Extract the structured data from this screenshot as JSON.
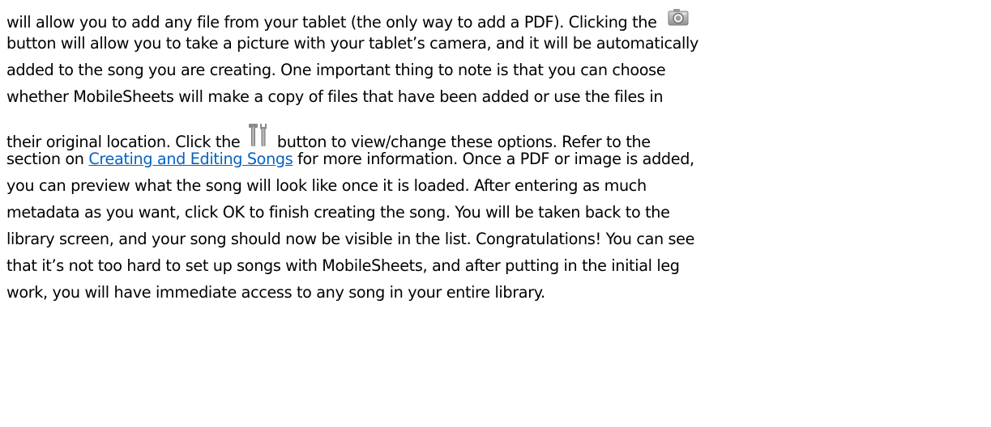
{
  "paragraph": {
    "line1": "will allow you to add any file from your tablet (the only way to add a PDF).  Clicking the",
    "line2": "button will allow you to take a picture with your tablet’s camera, and it will be automatically",
    "line3": "added to the song you are creating. One important thing to note is that you can choose",
    "line4": "whether MobileSheets will make a copy of files that have been added or use the files in",
    "line5_before": "their original location.   Click the",
    "line5_after": "button to view/change these options. Refer to the",
    "line6_before": "section on",
    "line6_link": "Creating and Editing Songs",
    "line6_after": " for more information. Once a PDF or image is added,",
    "line7": "you can preview what the song will look like once it is loaded.  After entering as much",
    "line8": "metadata as you want, click OK to finish creating the song.  You will be taken back to the",
    "line9": "library screen, and your song should now be visible in the list. Congratulations! You can see",
    "line10": "that it’s not too hard to set up songs with MobileSheets, and after putting in the initial leg",
    "line11": "work, you will have immediate access to any song in your entire library."
  },
  "icons": {
    "camera": "camera-icon",
    "tools": "tools-icon"
  }
}
